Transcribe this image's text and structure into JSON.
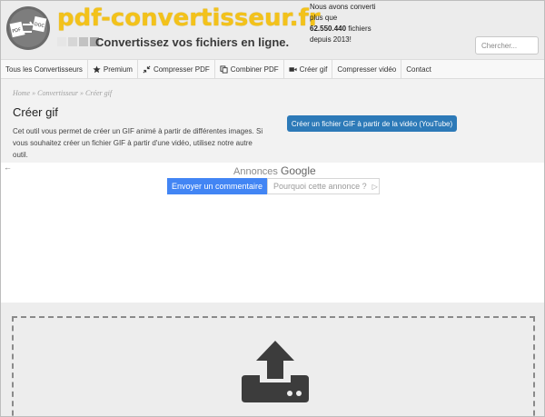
{
  "header": {
    "logo_text": "pdf-convertisseur.fr",
    "tagline": "Convertissez vos fichiers en ligne.",
    "stats_line1": "Nous avons converti",
    "stats_line2": "plus que",
    "stats_count": "62.550.440",
    "stats_unit": "fichiers",
    "stats_since": "depuis 2013!",
    "search_placeholder": "Chercher...",
    "logo_colors": {
      "yellow": "#f3c21a",
      "dark": "#3a3a3a"
    }
  },
  "nav": {
    "items": [
      {
        "label": "Tous les Convertisseurs",
        "icon": ""
      },
      {
        "label": "Premium",
        "icon": "star-icon"
      },
      {
        "label": "Compresser PDF",
        "icon": "compress-icon"
      },
      {
        "label": "Combiner PDF",
        "icon": "copy-icon"
      },
      {
        "label": "Créer gif",
        "icon": "video-camera-icon"
      },
      {
        "label": "Compresser vidéo",
        "icon": ""
      },
      {
        "label": "Contact",
        "icon": ""
      }
    ]
  },
  "breadcrumb": {
    "home": "Home",
    "sep": "»",
    "section": "Convertisseur",
    "current": "Créer gif"
  },
  "main": {
    "title": "Créer gif",
    "description": "Cet outil vous permet de créer un GIF animé à partir de différentes images. Si vous souhaitez créer un fichier GIF à partir d'une vidéo, utilisez notre autre outil.",
    "cta_label": "Créer un fichier GIF à partir de la vidéo (YouTube)",
    "accent_color": "#2d7ab8"
  },
  "ad": {
    "back_arrow": "←",
    "label_prefix": "Annonces",
    "label_brand": "Google",
    "feedback_button": "Envoyer un commentaire",
    "why_button": "Pourquoi cette annonce ?",
    "why_icon": "▷"
  },
  "upload": {
    "icon": "upload-tray-icon"
  }
}
